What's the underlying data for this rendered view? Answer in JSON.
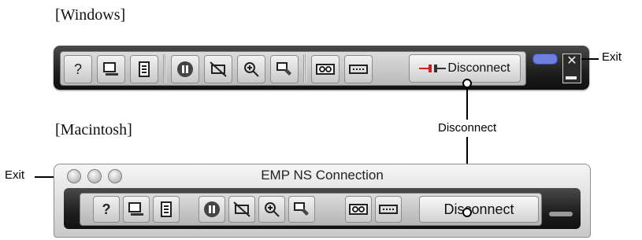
{
  "headings": {
    "windows": "[Windows]",
    "macintosh": "[Macintosh]"
  },
  "callouts": {
    "windows_exit": "Exit",
    "disconnect": "Disconnect",
    "mac_exit": "Exit"
  },
  "windows_toolbar": {
    "buttons": [
      "help",
      "display",
      "page",
      "pause",
      "av-mute",
      "e-zoom",
      "settings",
      "videotape",
      "keyboard"
    ],
    "disconnect_label": "Disconnect"
  },
  "mac_window": {
    "title": "EMP NS Connection",
    "buttons": [
      "help",
      "display",
      "page",
      "pause",
      "av-mute",
      "e-zoom",
      "settings",
      "videotape",
      "keyboard"
    ],
    "disconnect_label": "Disconnect"
  },
  "icons": {
    "help": "question-icon",
    "display": "monitor-icon",
    "page": "document-icon",
    "pause": "pause-icon",
    "av-mute": "mute-icon",
    "e-zoom": "zoom-icon",
    "settings": "tool-icon",
    "videotape": "tape-icon",
    "keyboard": "keyboard-icon"
  }
}
